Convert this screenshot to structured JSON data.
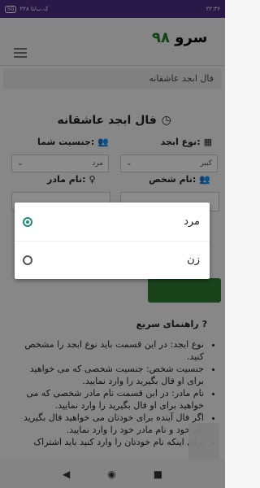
{
  "status": {
    "time": "۲۲:۳۶",
    "left_text": "۲۲۸ ک.ب/ثا",
    "data_pill": "5G"
  },
  "app": {
    "logo_text": "سرو",
    "logo_num": "۹۸"
  },
  "breadcrumb": "فال ابجد عاشقانه",
  "page_title": "فال ابجد عاشقانه",
  "form": {
    "abjad_label": "نوع ابجد:",
    "abjad_value": "کبیر",
    "gender_label": "جنسیت شما:",
    "gender_value": "مرد",
    "person_label": "نام شخص:",
    "mother_label": "نام مادر:"
  },
  "dialog": {
    "options": [
      "مرد",
      "زن"
    ],
    "selected_index": 0
  },
  "help": {
    "title": "راهنمای سریع",
    "items": [
      "نوع ابجد: در این قسمت باید نوع ابجد را مشخص کنید.",
      "جنسیت شخص: جنسیت شخصی که می خواهید برای او فال بگیرید را وارد نمایید.",
      "نام مادر: در این قسمت نام مادر شخصی که می خواهید برای او فال بگیرید را وارد نمایید.",
      "اگر فال آینده برای خودتان می خواهید فال بگیرید نام خود و نام مادر خود را وارد نمایید.",
      "برای اینکه نام خودتان را وارد کنید باید اشتراک"
    ]
  },
  "icons": {
    "calculator": "calculator-icon",
    "users": "users-icon",
    "user": "user-icon",
    "clock": "clock-icon",
    "question": "question-icon"
  },
  "colors": {
    "status_bg": "#4a2f86",
    "green": "#2e7d32",
    "radio_teal": "#1d8c7b"
  }
}
